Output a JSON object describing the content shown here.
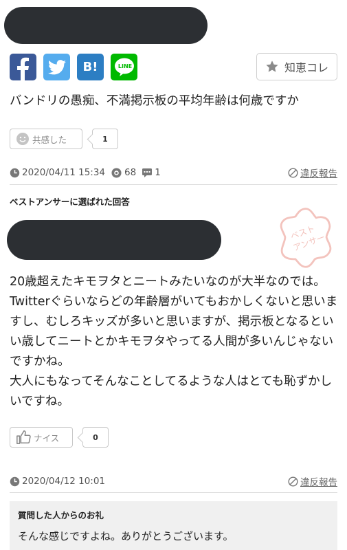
{
  "share": {
    "hatena_label": "B!",
    "line_label": "LINE",
    "chie_label": "知恵コレ"
  },
  "question": {
    "text": "バンドリの愚痴、不満掲示板の平均年齢は何歳ですか",
    "empathy_label": "共感した",
    "empathy_count": "1",
    "date": "2020/04/11 15:34",
    "views": "68",
    "answers": "1",
    "report_label": "違反報告"
  },
  "best_answer": {
    "section_label": "ベストアンサーに選ばれた回答",
    "stamp_text": "ベスト アンサー",
    "text": "20歳超えたキモヲタとニートみたいなのが大半なのでは。Twitterぐらいならどの年齢層がいてもおかしくないと思いますし、むしろキッズが多いと思いますが、掲示板となるといい歳してニートとかキモヲタやってる人間が多いんじゃないですかね。\n大人にもなってそんなことしてるような人はとても恥ずかしいですね。",
    "nice_label": "ナイス",
    "nice_count": "0",
    "date": "2020/04/12 10:01",
    "report_label": "違反報告"
  },
  "thanks": {
    "title": "質問した人からのお礼",
    "text": "そんな感じですよね。ありがとうございます。"
  },
  "colors": {
    "facebook": "#3b5998",
    "twitter": "#55acee",
    "hatena": "#2c7ec3",
    "line": "#00b900",
    "stamp": "#f3c3bd"
  }
}
